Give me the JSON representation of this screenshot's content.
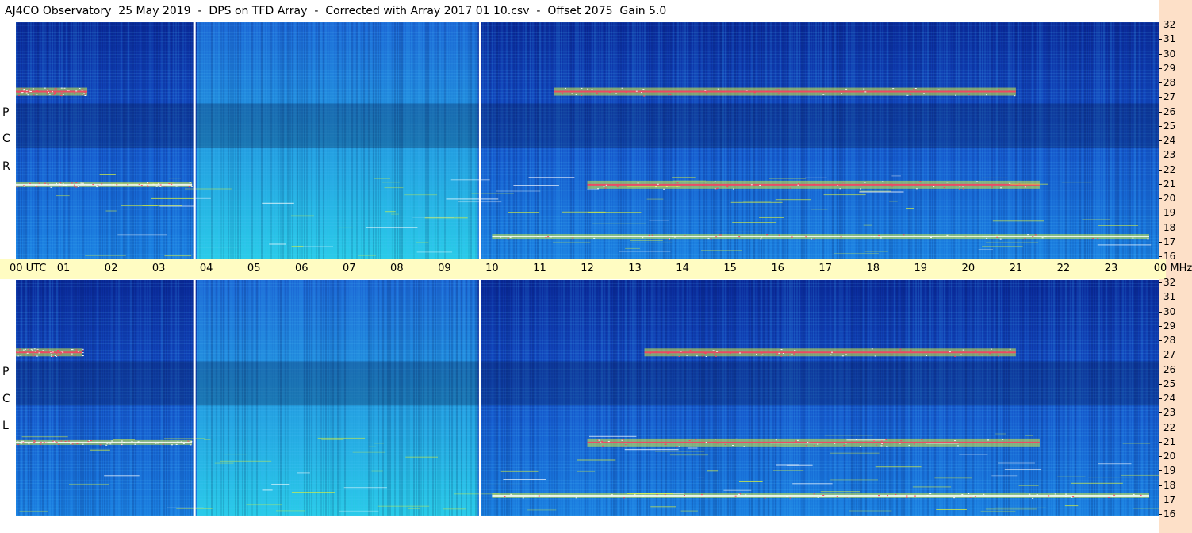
{
  "title": "AJ4CO Observatory  25 May 2019  -  DPS on TFD Array  -  Corrected with Array 2017 01 10.csv  -  Offset 2075  Gain 5.0",
  "colors": {
    "band": "#fffcc2",
    "strip": "#fde0c8",
    "background_low": "#0a2a9a",
    "background_mid": "#1a7fe0",
    "background_high": "#2ad0e8",
    "burst": "#ff3a60",
    "emission": "#d8f040"
  },
  "chart_data": [
    {
      "type": "heatmap",
      "panel": "top",
      "polarization": "R C P",
      "x_label": "UTC",
      "y_unit": "MHz",
      "ylim": [
        16,
        32
      ],
      "xlim": [
        0,
        24
      ],
      "x_ticks": [
        "00",
        "01",
        "02",
        "03",
        "04",
        "05",
        "06",
        "07",
        "08",
        "09",
        "10",
        "11",
        "12",
        "13",
        "14",
        "15",
        "16",
        "17",
        "18",
        "19",
        "20",
        "21",
        "22",
        "23",
        "00"
      ],
      "y_ticks": [
        "32",
        "31",
        "30",
        "29",
        "28",
        "27",
        "26",
        "25",
        "24",
        "23",
        "22",
        "21",
        "20",
        "19",
        "18",
        "17",
        "16"
      ],
      "data_gaps_utc": [
        3.75,
        9.75
      ],
      "strong_bands": [
        {
          "freq_mhz": 27.3,
          "start_utc": 0.0,
          "end_utc": 1.5,
          "level": "high"
        },
        {
          "freq_mhz": 27.3,
          "start_utc": 11.3,
          "end_utc": 21.0,
          "level": "high"
        },
        {
          "freq_mhz": 21.0,
          "start_utc": 0.0,
          "end_utc": 3.7,
          "level": "medium"
        },
        {
          "freq_mhz": 21.0,
          "start_utc": 12.0,
          "end_utc": 21.5,
          "level": "high"
        },
        {
          "freq_mhz": 17.5,
          "start_utc": 10.0,
          "end_utc": 23.8,
          "level": "medium"
        }
      ]
    },
    {
      "type": "heatmap",
      "panel": "bottom",
      "polarization": "L C P",
      "y_unit": "MHz",
      "ylim": [
        16,
        32
      ],
      "xlim": [
        0,
        24
      ],
      "y_ticks": [
        "32",
        "31",
        "30",
        "29",
        "28",
        "27",
        "26",
        "25",
        "24",
        "23",
        "22",
        "21",
        "20",
        "19",
        "18",
        "17",
        "16"
      ],
      "data_gaps_utc": [
        3.75,
        9.75
      ],
      "strong_bands": [
        {
          "freq_mhz": 27.1,
          "start_utc": 0.0,
          "end_utc": 1.4,
          "level": "high"
        },
        {
          "freq_mhz": 27.1,
          "start_utc": 13.2,
          "end_utc": 21.0,
          "level": "high"
        },
        {
          "freq_mhz": 21.0,
          "start_utc": 0.0,
          "end_utc": 3.7,
          "level": "medium"
        },
        {
          "freq_mhz": 21.0,
          "start_utc": 12.0,
          "end_utc": 21.5,
          "level": "high"
        },
        {
          "freq_mhz": 17.4,
          "start_utc": 10.0,
          "end_utc": 23.8,
          "level": "medium"
        }
      ]
    }
  ],
  "ticks_top_label": "00 UTC",
  "ticks_end_label": "00 MHz"
}
